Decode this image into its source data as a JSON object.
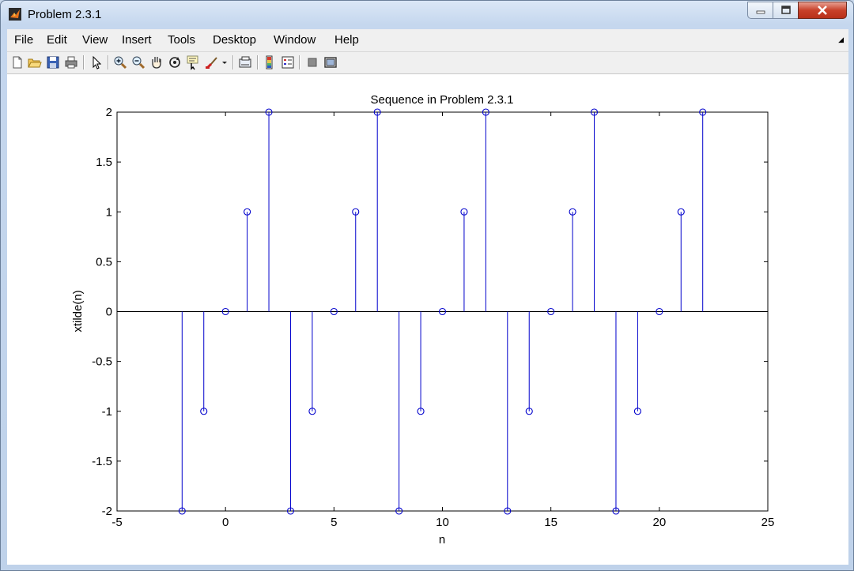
{
  "window": {
    "title": "Problem 2.3.1"
  },
  "menu": [
    "File",
    "Edit",
    "View",
    "Insert",
    "Tools",
    "Desktop",
    "Window",
    "Help"
  ],
  "toolbar": [
    "new-figure-icon",
    "open-file-icon",
    "save-figure-icon",
    "print-figure-icon",
    "edit-plot-icon",
    "zoom-in-icon",
    "zoom-out-icon",
    "pan-icon",
    "rotate-3d-icon",
    "data-cursor-icon",
    "brush-icon",
    "link-plot-icon",
    "insert-colorbar-icon",
    "insert-legend-icon",
    "hide-plot-tools-icon",
    "show-plot-tools-icon"
  ],
  "colors": {
    "stem": "#0000cc",
    "axes": "#000000",
    "background": "#ffffff"
  },
  "chart_data": {
    "type": "stem",
    "title": "Sequence in Problem 2.3.1",
    "xlabel": "n",
    "ylabel": "xtilde(n)",
    "xlim": [
      -5,
      25
    ],
    "ylim": [
      -2,
      2
    ],
    "xticks": [
      "-5",
      "0",
      "5",
      "10",
      "15",
      "20",
      "25"
    ],
    "yticks": [
      "-2",
      "-1.5",
      "-1",
      "-0.5",
      "0",
      "0.5",
      "1",
      "1.5",
      "2"
    ],
    "grid": true,
    "grid_style": "dotted",
    "x": [
      -2,
      -1,
      0,
      1,
      2,
      3,
      4,
      5,
      6,
      7,
      8,
      9,
      10,
      11,
      12,
      13,
      14,
      15,
      16,
      17,
      18,
      19,
      20,
      21,
      22
    ],
    "y": [
      -2,
      -1,
      0,
      1,
      2,
      -2,
      -1,
      0,
      1,
      2,
      -2,
      -1,
      0,
      1,
      2,
      -2,
      -1,
      0,
      1,
      2,
      -2,
      -1,
      0,
      1,
      2
    ]
  }
}
